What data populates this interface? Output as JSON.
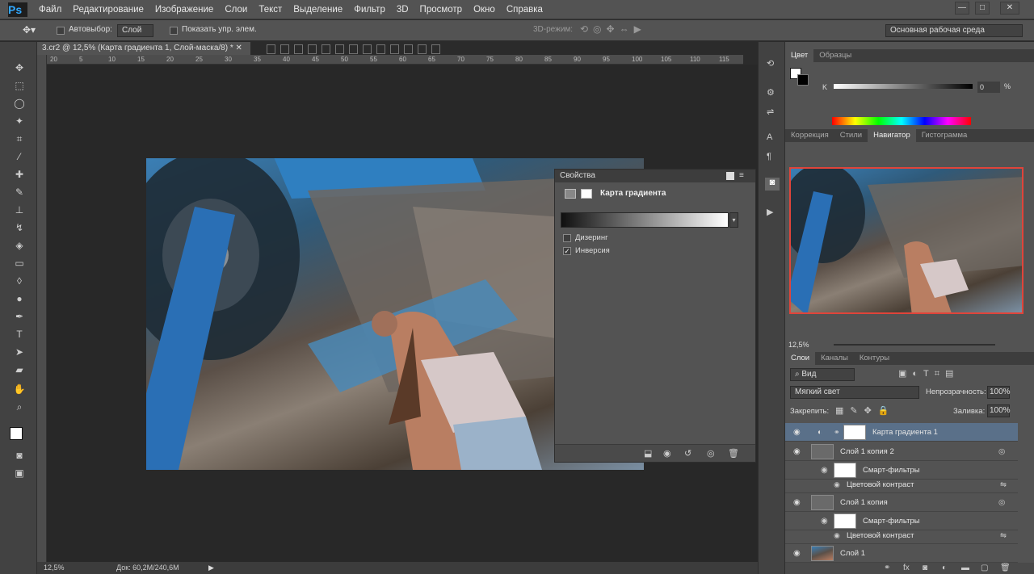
{
  "app": {
    "logo": "Ps"
  },
  "menu": [
    "Файл",
    "Редактирование",
    "Изображение",
    "Слои",
    "Текст",
    "Выделение",
    "Фильтр",
    "3D",
    "Просмотр",
    "Окно",
    "Справка"
  ],
  "window_controls": [
    "—",
    "□",
    "✕"
  ],
  "options": {
    "autoselect_label": "Автовыбор:",
    "autoselect_value": "Слой",
    "show_controls_label": "Показать упр. элем.",
    "mode3d_label": "3D-режим:",
    "workspace": "Основная рабочая среда"
  },
  "document": {
    "tab_title": "3.cr2 @ 12,5% (Карта градиента 1, Слой-маска/8) *",
    "ruler_ticks": [
      "20",
      "5",
      "10",
      "15",
      "20",
      "25",
      "30",
      "35",
      "40",
      "45",
      "50",
      "55",
      "60",
      "65",
      "70",
      "75",
      "80",
      "85",
      "90",
      "95",
      "100",
      "105",
      "110",
      "115"
    ]
  },
  "status": {
    "zoom": "12,5%",
    "doc": "Док: 60,2M/240,6M"
  },
  "properties": {
    "title": "Свойства",
    "type": "Карта градиента",
    "dither_label": "Дизеринг",
    "dither": false,
    "reverse_label": "Инверсия",
    "reverse": true
  },
  "color_panel": {
    "tabs": [
      "Цвет",
      "Образцы"
    ],
    "channel": "K",
    "value": "0",
    "unit": "%"
  },
  "nav_panel": {
    "tabs": [
      "Коррекция",
      "Стили",
      "Навигатор",
      "Гистограмма"
    ],
    "active": "Навигатор",
    "zoom": "12,5%"
  },
  "layers_panel": {
    "tabs": [
      "Слои",
      "Каналы",
      "Контуры"
    ],
    "filter": "Вид",
    "blend_mode": "Мягкий свет",
    "opacity_label": "Непрозрачность:",
    "opacity": "100%",
    "lock_label": "Закрепить:",
    "fill_label": "Заливка:",
    "fill": "100%",
    "layers": [
      {
        "name": "Карта градиента 1",
        "selected": true
      },
      {
        "name": "Слой 1 копия 2"
      },
      {
        "name": "Смарт-фильтры"
      },
      {
        "name": "Цветовой контраст"
      },
      {
        "name": "Слой 1 копия"
      },
      {
        "name": "Смарт-фильтры"
      },
      {
        "name": "Цветовой контраст"
      },
      {
        "name": "Слой 1"
      }
    ]
  },
  "colors": {
    "accent": "#31a8ff",
    "selected_layer": "#5a7089",
    "nav_frame": "#e0443a"
  }
}
